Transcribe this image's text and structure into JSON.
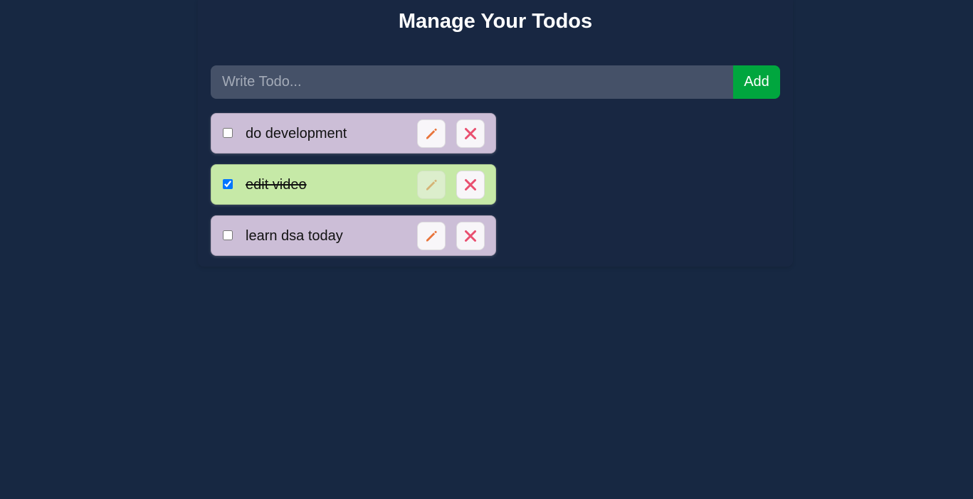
{
  "header": {
    "title": "Manage Your Todos"
  },
  "form": {
    "placeholder": "Write Todo...",
    "value": "",
    "add_label": "Add"
  },
  "colors": {
    "background": "#172842",
    "pending_item": "#ccbed7",
    "completed_item": "#c6e9a7",
    "add_button": "#00a63e",
    "edit_icon": "#e8743b",
    "delete_icon": "#e94f6f"
  },
  "todos": [
    {
      "text": "do development",
      "completed": false,
      "edit_icon": "pencil-icon",
      "delete_icon": "close-icon"
    },
    {
      "text": "edit video",
      "completed": true,
      "edit_icon": "pencil-icon",
      "delete_icon": "close-icon"
    },
    {
      "text": "learn dsa today",
      "completed": false,
      "edit_icon": "pencil-icon",
      "delete_icon": "close-icon"
    }
  ]
}
